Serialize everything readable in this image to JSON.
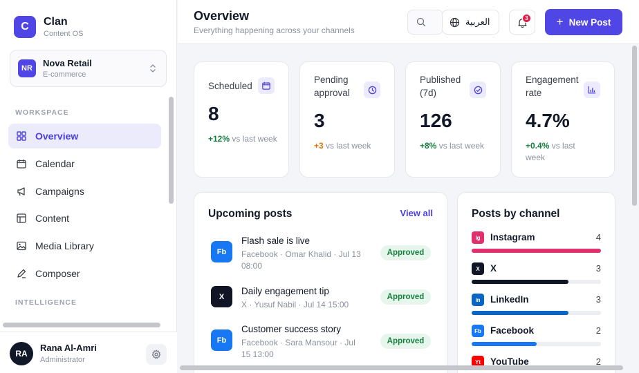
{
  "brand": {
    "logo_letter": "C",
    "name": "Clan",
    "subtitle": "Content OS"
  },
  "org": {
    "initials": "NR",
    "name": "Nova Retail",
    "type": "E-commerce"
  },
  "sidebar": {
    "workspace_label": "WORKSPACE",
    "intelligence_label": "INTELLIGENCE",
    "items": [
      {
        "label": "Overview",
        "icon": "grid-icon",
        "active": true
      },
      {
        "label": "Calendar",
        "icon": "calendar-icon"
      },
      {
        "label": "Campaigns",
        "icon": "megaphone-icon"
      },
      {
        "label": "Content",
        "icon": "layout-icon"
      },
      {
        "label": "Media Library",
        "icon": "image-icon"
      },
      {
        "label": "Composer",
        "icon": "pen-icon"
      }
    ]
  },
  "user": {
    "initials": "RA",
    "name": "Rana Al-Amri",
    "role": "Administrator"
  },
  "header": {
    "title": "Overview",
    "subtitle": "Everything happening across your channels",
    "language_label": "العربية",
    "notification_count": "3",
    "new_post_label": "New Post"
  },
  "stats": [
    {
      "label": "Scheduled",
      "value": "8",
      "delta": "+12%",
      "delta_text": " vs last week",
      "delta_color": "#15803d",
      "icon": "calendar-icon"
    },
    {
      "label": "Pending approval",
      "value": "3",
      "delta": "+3",
      "delta_text": " vs last week",
      "delta_color": "#d97706",
      "icon": "clock-icon"
    },
    {
      "label": "Published (7d)",
      "value": "126",
      "delta": "+8%",
      "delta_text": " vs last week",
      "delta_color": "#15803d",
      "icon": "check-circle-icon"
    },
    {
      "label": "Engagement rate",
      "value": "4.7%",
      "delta": "+0.4%",
      "delta_text": " vs last week",
      "delta_color": "#15803d",
      "icon": "bar-chart-icon"
    }
  ],
  "upcoming": {
    "title": "Upcoming posts",
    "view_all": "View all",
    "posts": [
      {
        "icon_text": "Fb",
        "icon_color": "#1877f2",
        "title": "Flash sale is live",
        "meta": "Facebook · Omar Khalid · Jul 13 08:00",
        "status": "Approved"
      },
      {
        "icon_text": "X",
        "icon_color": "#0f1524",
        "title": "Daily engagement tip",
        "meta": "X · Yusuf Nabil · Jul 14 15:00",
        "status": "Approved"
      },
      {
        "icon_text": "Fb",
        "icon_color": "#1877f2",
        "title": "Customer success story",
        "meta": "Facebook · Sara Mansour · Jul 15 13:00",
        "status": "Approved"
      }
    ]
  },
  "channels": {
    "title": "Posts by channel",
    "max": 4,
    "items": [
      {
        "badge": "Ig",
        "name": "Instagram",
        "count": 4,
        "color": "#e1306c"
      },
      {
        "badge": "X",
        "name": "X",
        "count": 3,
        "color": "#0f1524"
      },
      {
        "badge": "in",
        "name": "LinkedIn",
        "count": 3,
        "color": "#0a66c2"
      },
      {
        "badge": "Fb",
        "name": "Facebook",
        "count": 2,
        "color": "#1877f2"
      },
      {
        "badge": "Yt",
        "name": "YouTube",
        "count": 2,
        "color": "#ff0000"
      }
    ]
  }
}
